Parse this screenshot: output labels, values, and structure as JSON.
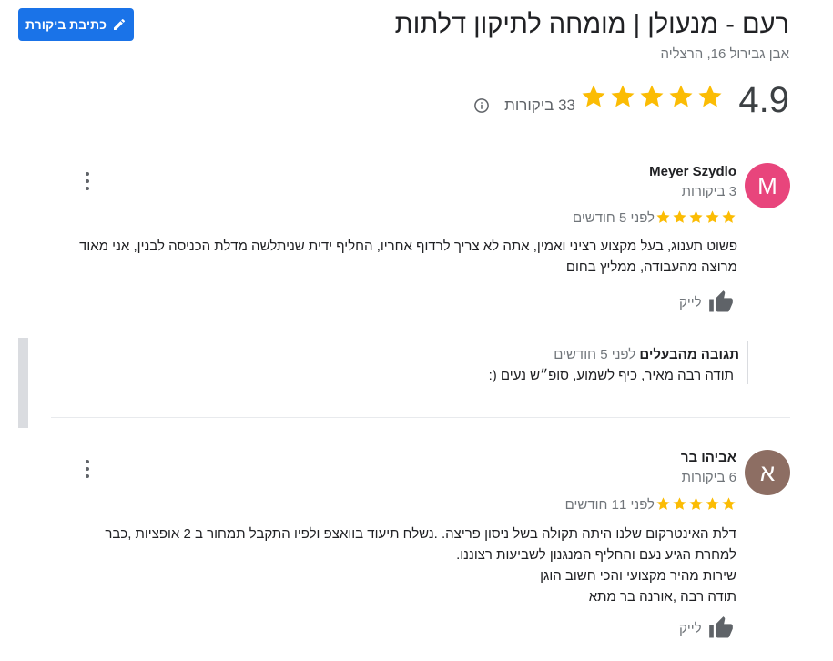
{
  "header": {
    "write_review_label": "כתיבת ביקורת",
    "business_title": "רעם - מנעולן | מומחה לתיקון דלתות",
    "address": "אבן גבירול 16, הרצליה",
    "rating": "4.9",
    "rating_value": 4.9,
    "stars_count": 5,
    "review_count_label": "33 ביקורות"
  },
  "reviews": [
    {
      "avatar_letter": "M",
      "avatar_color": "#e8457c",
      "name": "Meyer Szydlo",
      "reviews_count": "3 ביקורות",
      "stars": 5,
      "time": "לפני 5 חודשים",
      "text": "פשוט תענוג, בעל מקצוע רציני ואמין, אתה לא צריך לרדוף אחריו, החליף ידית שניתלשה מדלת הכניסה לבנין, אני מאוד מרוצה מהעבודה, ממליץ בחום",
      "like_label": "לייק",
      "owner_reply": {
        "label": "תגובה מהבעלים",
        "time": "לפני 5 חודשים",
        "text": "תודה רבה מאיר, כיף לשמוע, סופ״ש נעים (:"
      }
    },
    {
      "avatar_letter": "א",
      "avatar_color": "#8d6e63",
      "name": "אביהו בר",
      "reviews_count": "6 ביקורות",
      "stars": 5,
      "time": "לפני 11 חודשים",
      "text_lines": [
        "דלת האינטרקום שלנו היתה תקולה בשל ניסון פריצה. .נשלח תיעוד בוואצפ  ולפיו התקבל תמחור  ב 2 אופציות ,כבר",
        "למחרת הגיע נעם  והחליף המנגנון לשביעות רצוננו.",
        "שירות מהיר מקצועי והכי חשוב הוגן",
        "תודה רבה ,אורנה בר מתא"
      ],
      "like_label": "לייק"
    }
  ],
  "colors": {
    "accent": "#1a73e8",
    "star": "#fbbc04"
  }
}
